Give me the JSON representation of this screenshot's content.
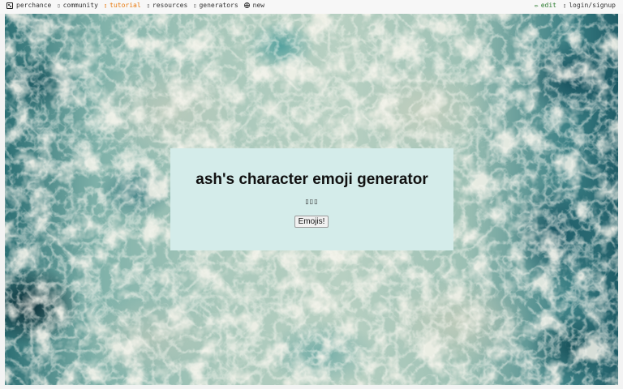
{
  "nav": {
    "left": [
      {
        "label": "perchance",
        "icon": "dice-icon"
      },
      {
        "label": "community",
        "icon": "chat-icon"
      },
      {
        "label": "tutorial",
        "icon": "book-icon"
      },
      {
        "label": "resources",
        "icon": "resources-icon"
      },
      {
        "label": "generators",
        "icon": "generators-icon"
      },
      {
        "label": "new",
        "icon": "plus-circle-icon"
      }
    ],
    "right": [
      {
        "label": "edit",
        "icon": "pencil-icon"
      },
      {
        "label": "login/signup",
        "icon": "user-icon"
      }
    ]
  },
  "background": {
    "icon": "ocean-foam-image"
  },
  "card": {
    "title": "ash's character emoji generator",
    "emoji_output": "▯▯▯",
    "button_label": "Emojis!"
  },
  "colors": {
    "card_bg": "#d4ecea",
    "tutorial": "#e8790e",
    "edit": "#2e7d32"
  }
}
